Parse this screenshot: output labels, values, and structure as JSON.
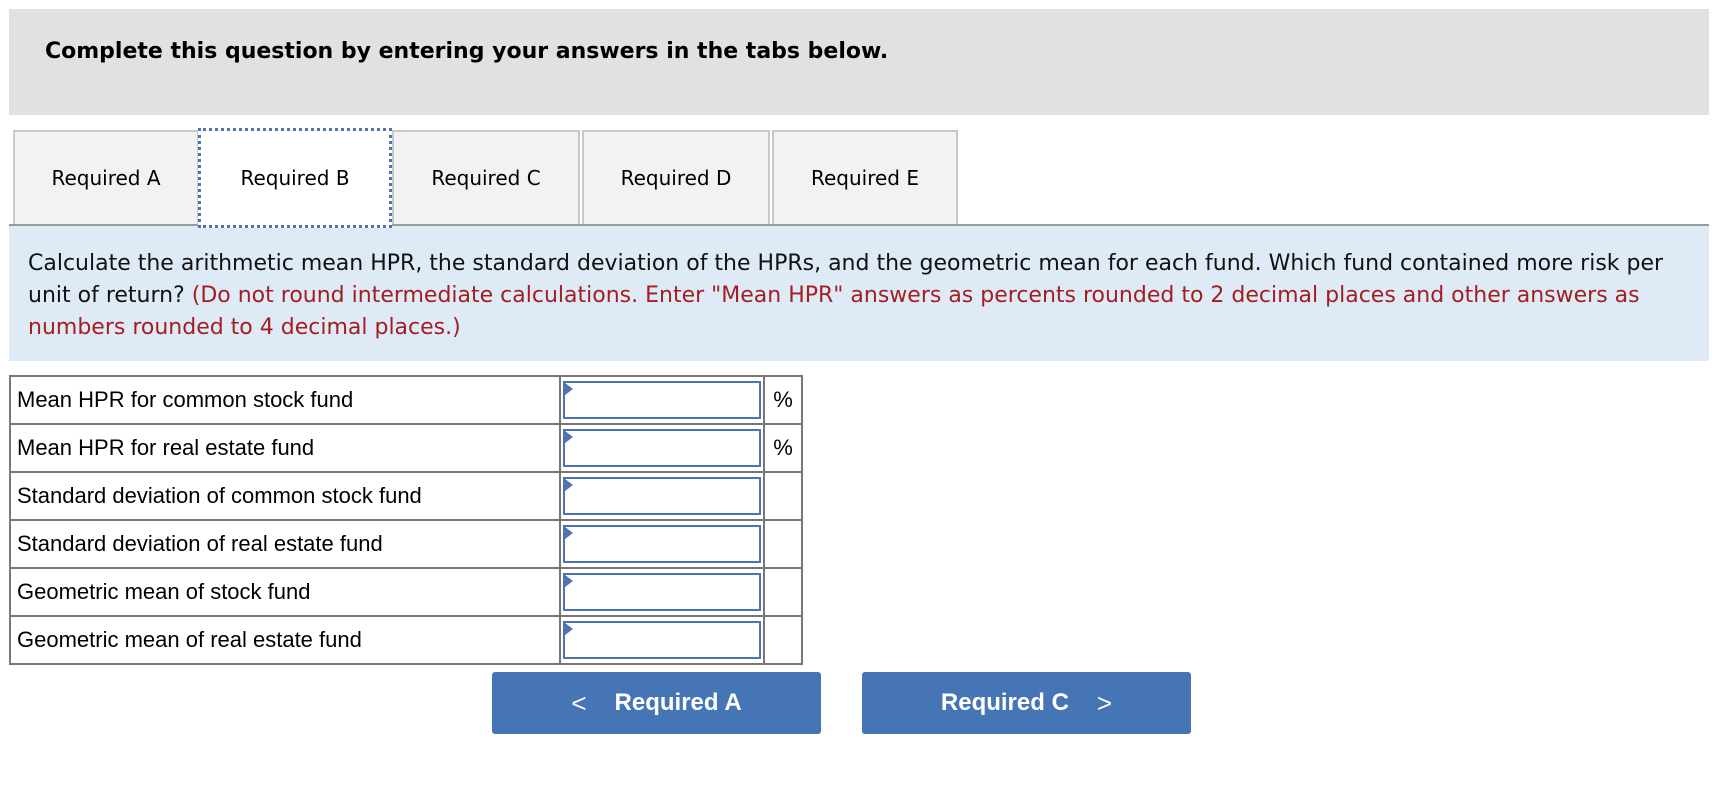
{
  "header": {
    "title": "Complete this question by entering your answers in the tabs below."
  },
  "tabs": [
    {
      "label": "Required A",
      "active": false
    },
    {
      "label": "Required B",
      "active": true
    },
    {
      "label": "Required C",
      "active": false
    },
    {
      "label": "Required D",
      "active": false
    },
    {
      "label": "Required E",
      "active": false
    }
  ],
  "prompt": {
    "question": "Calculate the arithmetic mean HPR, the standard deviation of the HPRs, and the geometric mean for each fund. Which fund contained more risk per unit of  return? ",
    "instruction": "(Do not round intermediate calculations. Enter \"Mean HPR\" answers as percents rounded to 2 decimal places and other answers as numbers rounded to 4 decimal places.)"
  },
  "rows": [
    {
      "label": "Mean HPR for common stock fund",
      "value": "",
      "unit": "%"
    },
    {
      "label": "Mean HPR for real estate fund",
      "value": "",
      "unit": "%"
    },
    {
      "label": "Standard deviation of common stock fund",
      "value": "",
      "unit": ""
    },
    {
      "label": "Standard deviation of real estate fund",
      "value": "",
      "unit": ""
    },
    {
      "label": "Geometric mean of stock fund",
      "value": "",
      "unit": ""
    },
    {
      "label": "Geometric mean of real estate fund",
      "value": "",
      "unit": ""
    }
  ],
  "nav": {
    "prev_label": "Required A",
    "next_label": "Required C",
    "prev_icon": "chevron-left-icon",
    "next_icon": "chevron-right-icon"
  },
  "colors": {
    "accent": "#4675b5",
    "instruction": "#a31e1e",
    "prompt_bg": "#deebf7",
    "header_bg": "#e1e1e1"
  }
}
